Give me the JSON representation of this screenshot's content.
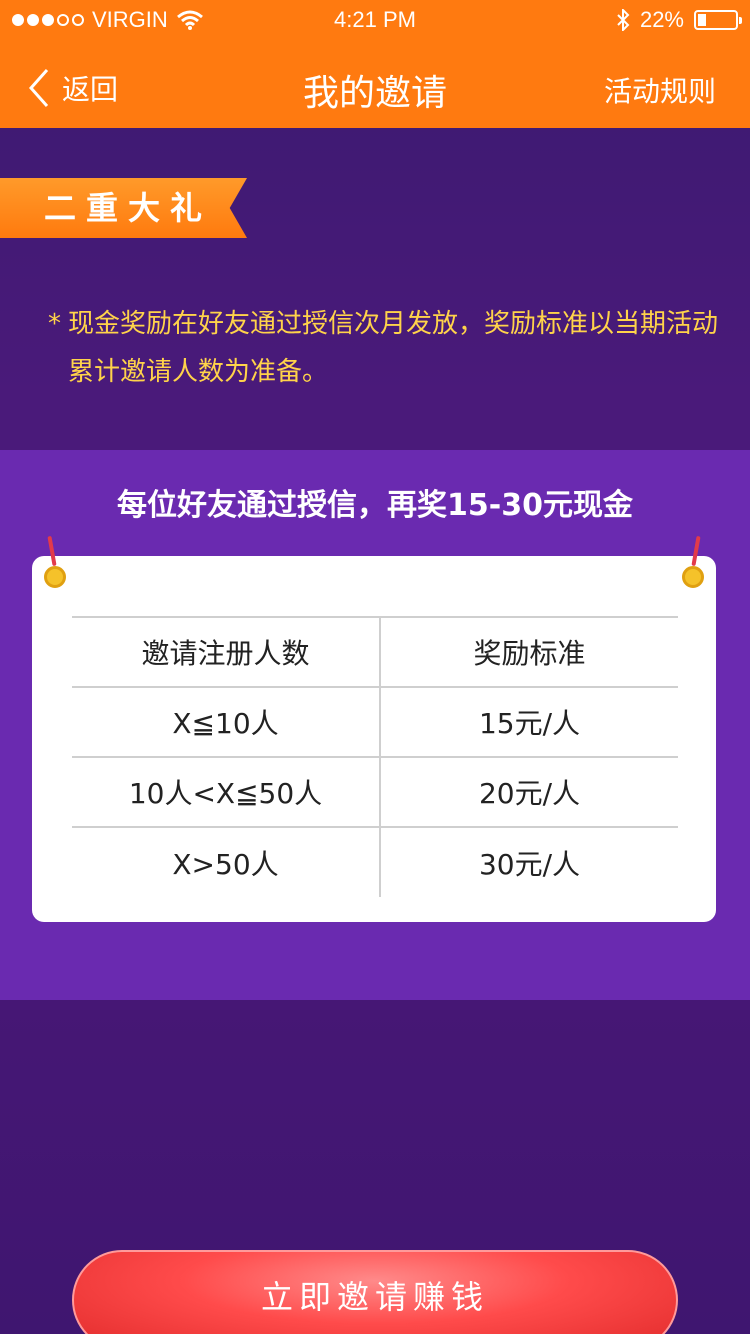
{
  "status_bar": {
    "carrier": "VIRGIN",
    "time": "4:21 PM",
    "battery": "22%",
    "battery_level": 0.22,
    "signal_bars": 3,
    "signal_total": 5
  },
  "nav": {
    "back_label": "返回",
    "title": "我的邀请",
    "rules_label": "活动规则"
  },
  "ribbon": {
    "label": "二重大礼"
  },
  "notice": {
    "star": "*",
    "text": "现金奖励在好友通过授信次月发放，奖励标准以当期活动累计邀请人数为准备。"
  },
  "panel": {
    "title": "每位好友通过授信，再奖15-30元现金",
    "table": {
      "headers": [
        "邀请注册人数",
        "奖励标准"
      ],
      "rows": [
        [
          "X≦10人",
          "15元/人"
        ],
        [
          "10人<X≦50人",
          "20元/人"
        ],
        [
          "X>50人",
          "30元/人"
        ]
      ]
    }
  },
  "cta": {
    "label": "立即邀请赚钱"
  },
  "colors": {
    "accent": "#ff7a10",
    "panel": "#6a2ab0",
    "notice": "#ffd34a",
    "cta": "#ff4b4b"
  }
}
